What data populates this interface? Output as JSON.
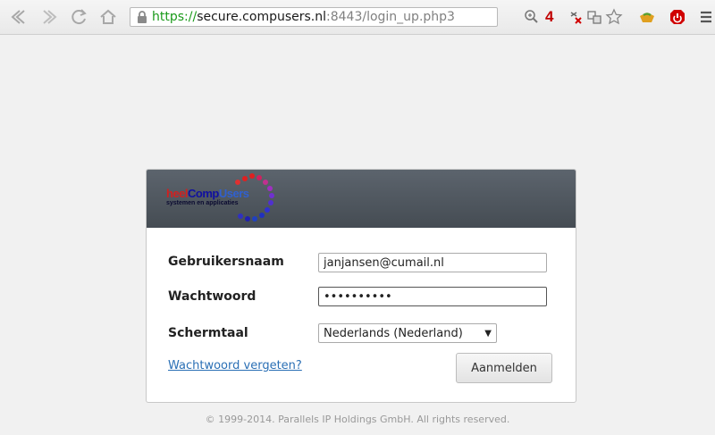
{
  "browser": {
    "url_scheme": "https://",
    "url_host": "secure.compusers.nl",
    "url_path": ":8443/login_up.php3",
    "badge_count": "4",
    "colors": {
      "url_scheme": "#1a9a1a",
      "badge": "#c00000"
    }
  },
  "logo": {
    "text_part1": "heel",
    "text_part2": "Comp",
    "text_part3": "Users",
    "subtitle": "systemen en applicaties"
  },
  "login": {
    "username_label": "Gebruikersnaam",
    "username_value": "janjansen@cumail.nl",
    "password_label": "Wachtwoord",
    "password_value": "••••••••••",
    "language_label": "Schermtaal",
    "language_value": "Nederlands (Nederland)",
    "forgot_link": "Wachtwoord vergeten?",
    "submit_label": "Aanmelden"
  },
  "footer": {
    "copyright": "© 1999-2014. Parallels IP Holdings GmbH. All rights reserved."
  }
}
